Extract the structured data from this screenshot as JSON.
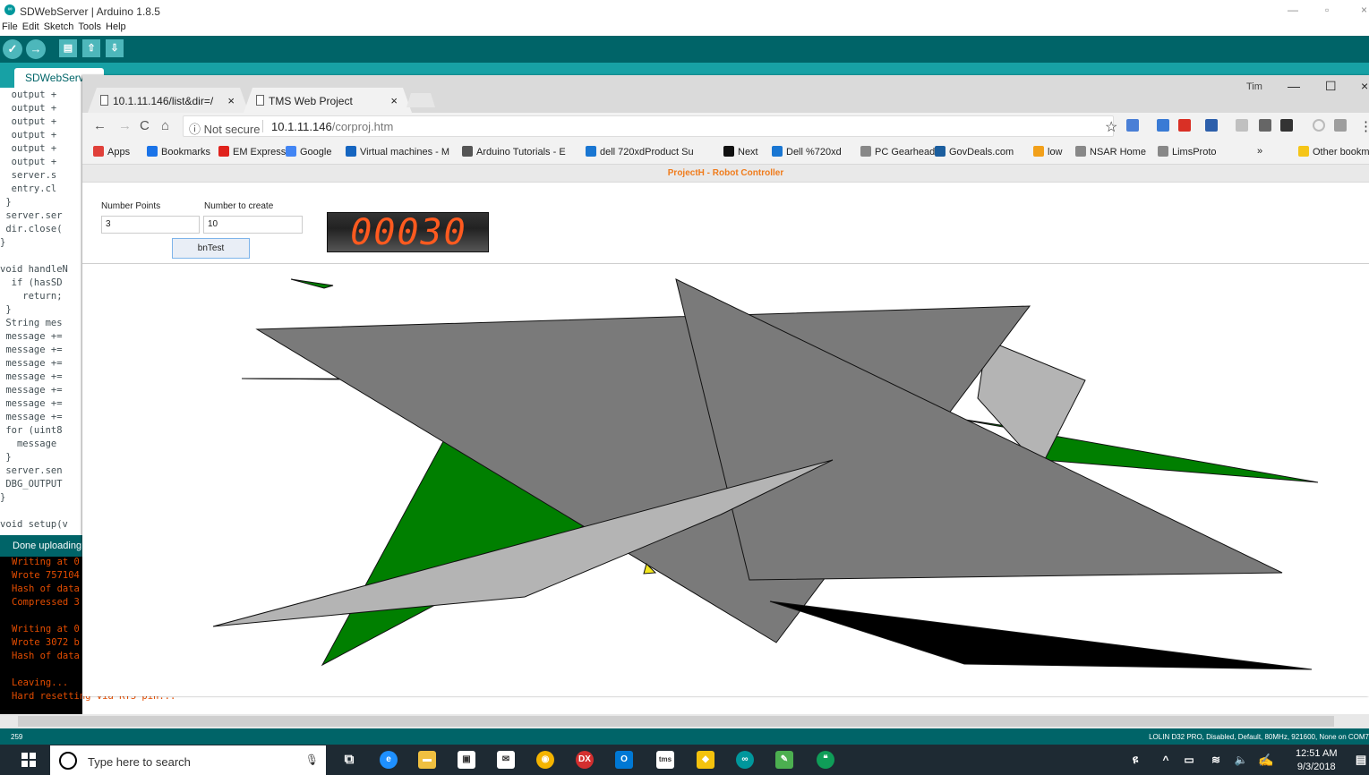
{
  "ide": {
    "window_title": "SDWebServer | Arduino 1.8.5",
    "logo_glyph": "∞",
    "menu": [
      "File",
      "Edit",
      "Sketch",
      "Tools",
      "Help"
    ],
    "toolbar": {
      "verify": "✓",
      "upload": "→",
      "new": "▤",
      "open": "⇧",
      "save": "⇩"
    },
    "tab_label": "SDWebServ",
    "code_lines": [
      "  output +",
      "  output +",
      "  output +",
      "  output +",
      "  output +",
      "  output +",
      "  server.s",
      "  entry.cl",
      " }",
      " server.ser",
      " dir.close(",
      "}",
      "",
      "void handleN",
      "  if (hasSD",
      "    return;",
      " }",
      " String mes",
      " message +=",
      " message +=",
      " message +=",
      " message +=",
      " message +=",
      " message +=",
      " message +=",
      " for (uint8",
      "   message",
      " }",
      " server.sen",
      " DBG_OUTPUT",
      "}",
      "",
      "void setup(v"
    ],
    "console_header": "Done uploading",
    "console_lines": [
      "Writing at 0",
      "Wrote 757104",
      "Hash of data",
      "Compressed 3",
      "",
      "Writing at 0",
      "Wrote 3072 b",
      "Hash of data",
      "",
      "Leaving...",
      "Hard resetting via RTS pin..."
    ],
    "status_line": "259",
    "status_board": "LOLIN D32 PRO, Disabled, Default, 80MHz, 921600, None on COM7"
  },
  "chrome": {
    "tabs": [
      {
        "label": "10.1.11.146/list&dir=/",
        "close": "×"
      },
      {
        "label": "TMS Web Project",
        "close": "×"
      }
    ],
    "user": "Tim",
    "nav": {
      "back": "←",
      "forward": "→",
      "reload": "C",
      "home": "⌂"
    },
    "security": "ⓘ Not secure",
    "url_host": "10.1.11.146",
    "url_path": "/corproj.htm",
    "star": "☆",
    "bookmarks": [
      {
        "label": "Apps",
        "color": "#e0403a"
      },
      {
        "label": "Bookmarks",
        "color": "#1a73e8"
      },
      {
        "label": "EM Express",
        "color": "#e0231d"
      },
      {
        "label": "Google",
        "color": "#4285f4"
      },
      {
        "label": "Virtual machines - M",
        "color": "#1565c0"
      },
      {
        "label": "Arduino Tutorials - E",
        "color": "#555555"
      },
      {
        "label": "dell 720xdProduct Su",
        "color": "#1976d2"
      },
      {
        "label": "Next",
        "color": "#111111"
      },
      {
        "label": "Dell %720xd",
        "color": "#1976d2"
      },
      {
        "label": "PC Gearhead",
        "color": "#888888"
      },
      {
        "label": "GovDeals.com",
        "color": "#1b5e9e"
      },
      {
        "label": "low",
        "color": "#f2a01a"
      },
      {
        "label": "NSAR Home",
        "color": "#888888"
      },
      {
        "label": "LimsProto",
        "color": "#888888"
      },
      {
        "label": "Other bookmarks",
        "color": "#f5c518"
      }
    ],
    "bookmarks_more": "»"
  },
  "app": {
    "header_title": "ProjectH - Robot Controller",
    "number_points_label": "Number Points",
    "number_points_value": "3",
    "number_to_create_label": "Number to create",
    "number_to_create_value": "10",
    "button_label": "bnTest",
    "counter_display": "00030"
  },
  "taskbar": {
    "search_placeholder": "Type here to search",
    "time": "12:51 AM",
    "date": "9/3/2018"
  }
}
